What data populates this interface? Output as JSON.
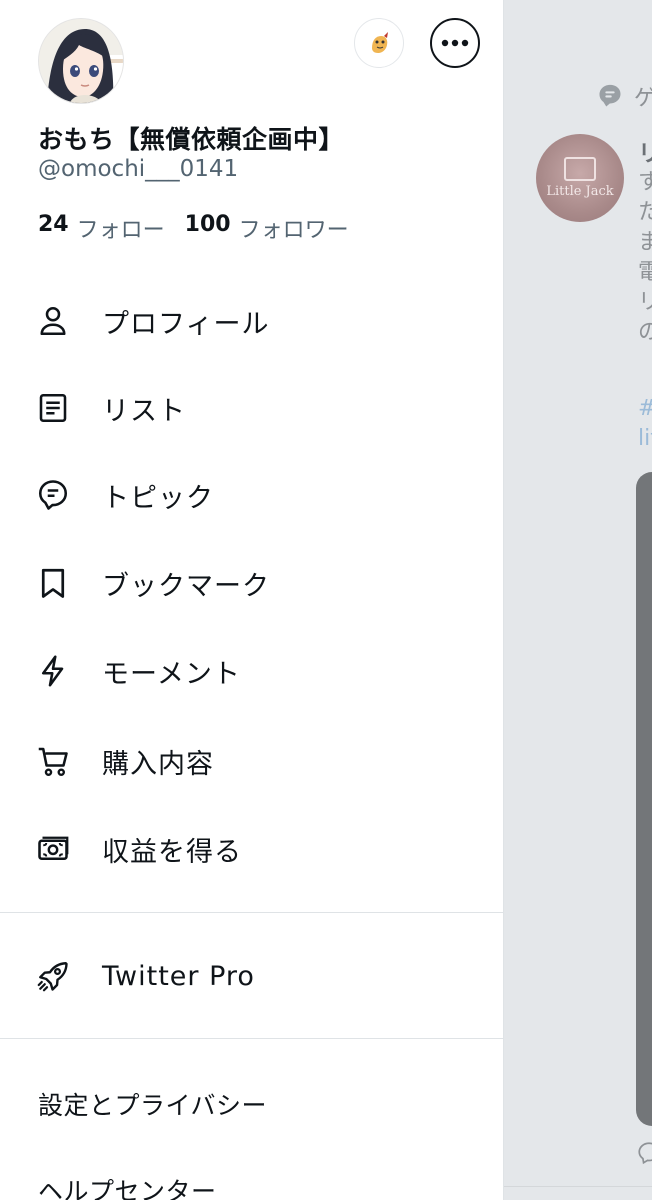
{
  "feed": {
    "context_label": "ゲ",
    "post_name": "リ",
    "post_body_lines": [
      "す",
      "た",
      "ま",
      "電",
      "リ",
      "の"
    ],
    "post_tag_lines": [
      "#",
      "lit"
    ],
    "avatar_text": "Little Jack"
  },
  "drawer": {
    "profile": {
      "display_name": "おもち【無償依頼企画中】",
      "handle": "@omochi___0141",
      "following_count": "24",
      "following_label": "フォロー",
      "followers_count": "100",
      "followers_label": "フォロワー"
    },
    "menu": [
      {
        "label": "プロフィール",
        "icon": "person-icon"
      },
      {
        "label": "リスト",
        "icon": "list-icon"
      },
      {
        "label": "トピック",
        "icon": "topic-icon"
      },
      {
        "label": "ブックマーク",
        "icon": "bookmark-icon"
      },
      {
        "label": "モーメント",
        "icon": "lightning-icon"
      },
      {
        "label": "購入内容",
        "icon": "cart-icon"
      },
      {
        "label": "収益を得る",
        "icon": "money-icon"
      }
    ],
    "pro": {
      "label": "Twitter Pro",
      "icon": "rocket-icon"
    },
    "settings": [
      {
        "label": "設定とプライバシー"
      },
      {
        "label": "ヘルプセンター"
      }
    ]
  },
  "colors": {
    "text_primary": "#0f1419",
    "text_secondary": "#536471",
    "divider": "#dfe3e6",
    "overlay_bg": "#e4e7ea"
  }
}
